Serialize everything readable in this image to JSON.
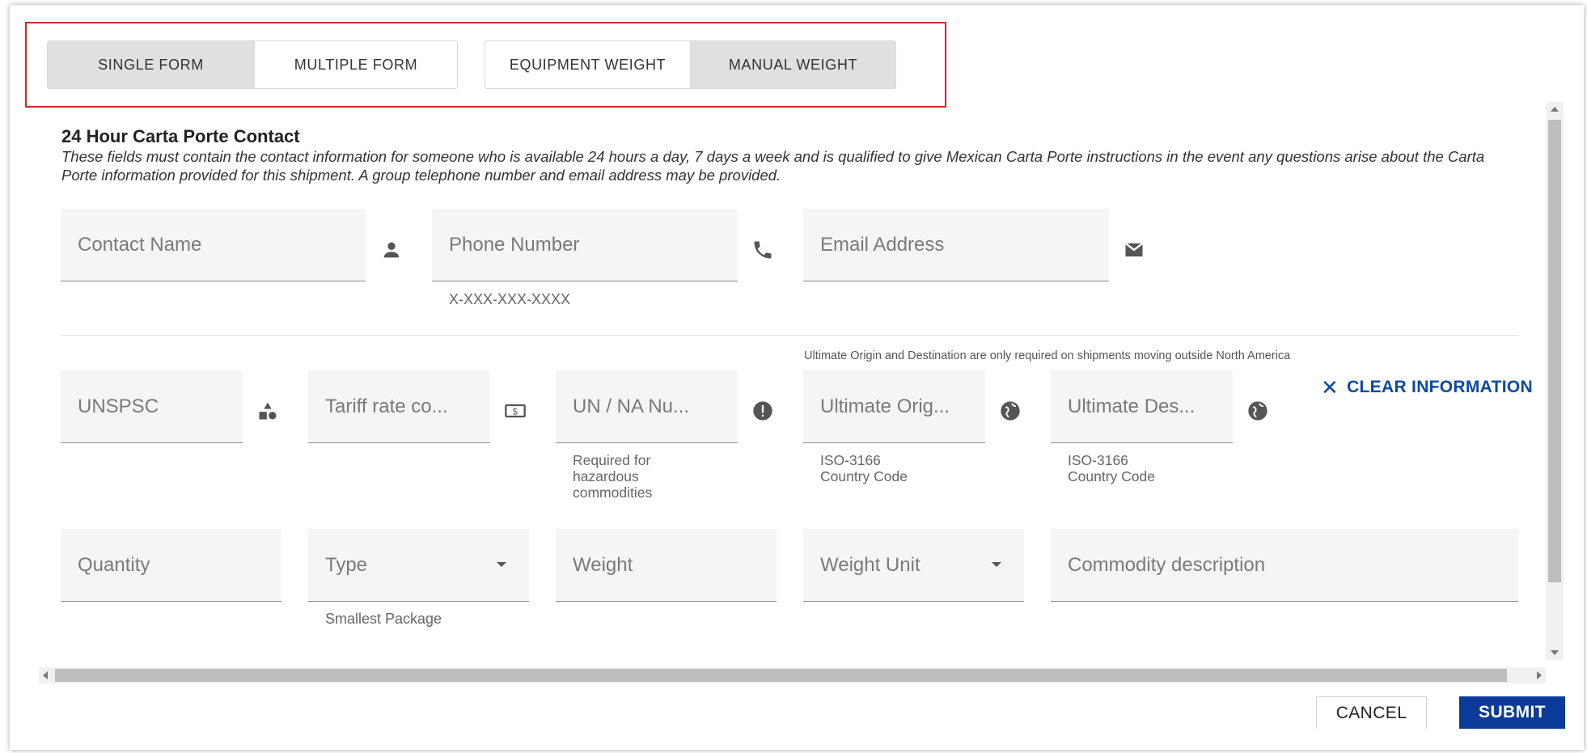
{
  "toggles": {
    "form_mode": [
      {
        "label": "SINGLE FORM",
        "active": true
      },
      {
        "label": "MULTIPLE FORM",
        "active": false
      }
    ],
    "weight_mode": [
      {
        "label": "EQUIPMENT WEIGHT",
        "active": false
      },
      {
        "label": "MANUAL WEIGHT",
        "active": true
      }
    ]
  },
  "contact_section": {
    "title": "24 Hour Carta Porte Contact",
    "description": "These fields must contain the contact information for someone who is available 24 hours a day, 7 days a week and is qualified to give Mexican Carta Porte instructions in the event any questions arise about the Carta Porte information provided for this shipment. A group telephone number and email address may be provided.",
    "fields": {
      "contact_name": {
        "placeholder": "Contact Name",
        "icon": "person-icon"
      },
      "phone_number": {
        "placeholder": "Phone Number",
        "hint": "X-XXX-XXX-XXXX",
        "icon": "phone-icon"
      },
      "email_address": {
        "placeholder": "Email Address",
        "icon": "email-icon"
      }
    }
  },
  "commodity_section": {
    "origin_note": "Ultimate Origin and Destination are only required on shipments moving outside North America",
    "clear_label": "CLEAR INFORMATION",
    "fields": {
      "unspsc": {
        "placeholder": "UNSPSC",
        "icon": "category-icon"
      },
      "tariff": {
        "placeholder": "Tariff rate co...",
        "icon": "money-icon"
      },
      "un_na": {
        "placeholder": "UN / NA Nu...",
        "icon": "alert-icon",
        "hint_lines": [
          "Required for",
          "hazardous",
          "commodities"
        ]
      },
      "ultimate_origin": {
        "placeholder": "Ultimate Orig...",
        "icon": "globe-icon",
        "hint_lines": [
          "ISO-3166",
          "Country Code"
        ]
      },
      "ultimate_destination": {
        "placeholder": "Ultimate Des...",
        "icon": "globe-icon",
        "hint_lines": [
          "ISO-3166",
          "Country Code"
        ]
      },
      "quantity": {
        "placeholder": "Quantity"
      },
      "type": {
        "placeholder": "Type",
        "hint": "Smallest Package"
      },
      "weight": {
        "placeholder": "Weight"
      },
      "weight_unit": {
        "placeholder": "Weight Unit"
      },
      "commodity_description": {
        "placeholder": "Commodity description"
      }
    }
  },
  "actions": {
    "cancel_label": "CANCEL",
    "submit_label": "SUBMIT"
  },
  "colors": {
    "accent": "#0b3a99",
    "link": "#0b4aa2",
    "highlight": "#e02020"
  }
}
